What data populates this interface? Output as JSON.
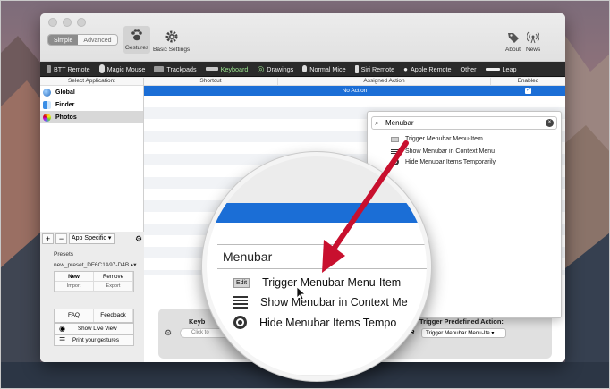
{
  "toolbar": {
    "mode_simple": "Simple",
    "mode_advanced": "Advanced",
    "gestures_label": "Gestures",
    "basic_settings_label": "Basic Settings",
    "about_label": "About",
    "news_label": "News"
  },
  "tabs": [
    "BTT Remote",
    "Magic Mouse",
    "Trackpads",
    "Keyboard",
    "Drawings",
    "Normal Mice",
    "Siri Remote",
    "Apple Remote",
    "Other",
    "Leap"
  ],
  "active_tab": "Keyboard",
  "sidebar": {
    "header": "Select Application:",
    "apps": [
      "Global",
      "Finder",
      "Photos"
    ],
    "app_specific": "App Specific",
    "presets_label": "Presets",
    "preset_name": "new_preset_DF6C1A97-D4B",
    "new_btn": "New",
    "remove_btn": "Remove",
    "import_btn": "Import",
    "export_btn": "Export",
    "faq_btn": "FAQ",
    "feedback_btn": "Feedback",
    "live_view_btn": "Show Live View",
    "print_btn": "Print your gestures"
  },
  "table": {
    "col_shortcut": "Shortcut",
    "col_action": "Assigned Action",
    "col_enabled": "Enabled",
    "selected_row_action": "No Action"
  },
  "config": {
    "keyboard_label": "Keyb",
    "click_placeholder": "Click to",
    "trigger_label": "Trigger Predefined Action:",
    "or_label": "OR",
    "trigger_value": "Trigger Menubar Menu-Ite"
  },
  "dropdown": {
    "search_value": "Menubar",
    "items": [
      "Trigger Menubar Menu-Item",
      "Show Menubar in Context Menu",
      "Hide Menubar Items Temporarily"
    ]
  },
  "zoom": {
    "search_value": "Menubar",
    "edit_tag": "Edit",
    "items": [
      "Trigger Menubar Menu-Item",
      "Show Menubar in Context Me",
      "Hide Menubar Items Tempo"
    ]
  }
}
